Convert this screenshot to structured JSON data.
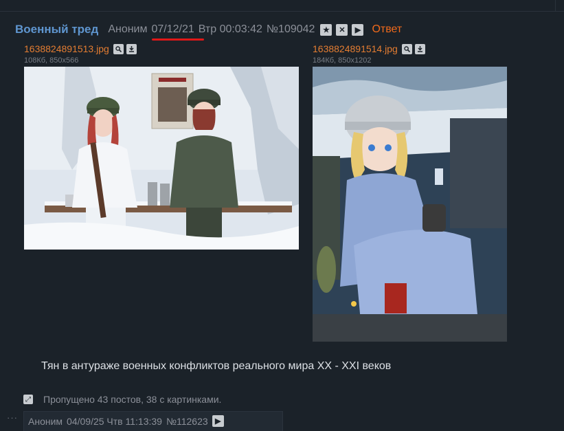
{
  "thread": {
    "subject": "Военный тред",
    "author": "Аноним",
    "date": "07/12/21",
    "weekday_time": "Втр 00:03:42",
    "post_number": "№109042",
    "reply_label": "Ответ",
    "icons": [
      "star-icon",
      "close-icon",
      "play-icon"
    ]
  },
  "files": [
    {
      "name": "1638824891513.jpg",
      "meta": "108Кб, 850x566"
    },
    {
      "name": "1638824891514.jpg",
      "meta": "184Кб, 850x1202"
    }
  ],
  "message": "Тян в антураже военных конфликтов реального мира XX - XXI веков",
  "omitted": {
    "text": "Пропущено 43 постов, 38 с картинками."
  },
  "reply": {
    "author": "Аноним",
    "datetime": "04/09/25 Чтв 11:13:39",
    "post_number": "№112623"
  },
  "colors": {
    "background": "#1b2229",
    "subject": "#5f96d0",
    "file_link": "#e47d32",
    "reply_link": "#f26a1b",
    "underline": "#e01818"
  }
}
